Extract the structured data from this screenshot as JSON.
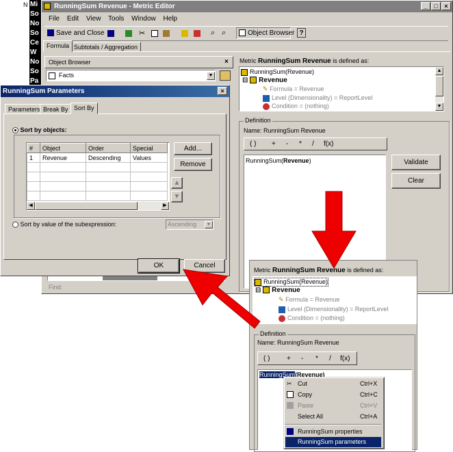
{
  "left_strip": {
    "items": [
      "Mi",
      "So",
      "No",
      "So",
      "Ce",
      "W",
      "No",
      "So",
      "Pa"
    ],
    "top_letter": "N"
  },
  "metric_editor": {
    "title": "RunningSum Revenue - Metric Editor",
    "menu": [
      "File",
      "Edit",
      "View",
      "Tools",
      "Window",
      "Help"
    ],
    "toolbar": {
      "save_close": "Save and Close",
      "object_browser": "Object Browser"
    },
    "tabs": [
      "Formula",
      "Subtotals / Aggregation"
    ],
    "object_browser": {
      "label": "Object Browser",
      "select": "Facts",
      "find": "Find:"
    },
    "defined_as": {
      "prefix": "Metric",
      "name": "RunningSum Revenue",
      "suffix": "is defined as:"
    },
    "tree": {
      "root": "RunningSum(Revenue)",
      "child": "Revenue",
      "formula": "Formula = Revenue",
      "level": "Level (Dimensionality) = ReportLevel",
      "condition": "Condition = (nothing)"
    },
    "definition": {
      "group": "Definition",
      "name_label": "Name:",
      "name_value": "RunningSum Revenue",
      "ops": [
        "( )",
        "+",
        "-",
        "*",
        "/",
        "f(x)"
      ],
      "expr_func": "RunningSum(",
      "expr_arg": "Revenue",
      "expr_close": ")",
      "validate": "Validate",
      "clear": "Clear"
    }
  },
  "params_dialog": {
    "title": "RunningSum Parameters",
    "tabs": [
      "Parameters",
      "Break By",
      "Sort By"
    ],
    "sort_by_objects": "Sort by objects:",
    "columns": [
      "#",
      "Object",
      "Order",
      "Special"
    ],
    "rows": [
      [
        "1",
        "Revenue",
        "Descending",
        "Values"
      ]
    ],
    "add": "Add...",
    "remove": "Remove",
    "sort_by_value": "Sort by value of the subexpression:",
    "order_select": "Ascending",
    "ok": "OK",
    "cancel": "Cancel"
  },
  "zoom_panel": {
    "defined_as": {
      "prefix": "Metric",
      "name": "RunningSum Revenue",
      "suffix": "is defined as:"
    },
    "tree": {
      "root": "RunningSum(Revenue)",
      "child": "Revenue",
      "formula": "Formula = Revenue",
      "level": "Level (Dimensionality) = ReportLevel",
      "condition": "Condition = (nothing)"
    },
    "definition": {
      "group": "Definition",
      "name_label": "Name:",
      "name_value": "RunningSum Revenue",
      "ops": [
        "( )",
        "+",
        "-",
        "*",
        "/",
        "f(x)"
      ],
      "expr_func": "RunningSum",
      "expr_rest": "(Revenue)"
    },
    "context_menu": [
      {
        "label": "Cut",
        "key": "Ctrl+X",
        "enabled": true
      },
      {
        "label": "Copy",
        "key": "Ctrl+C",
        "enabled": true
      },
      {
        "label": "Paste",
        "key": "Ctrl+V",
        "enabled": false
      },
      {
        "label": "Select All",
        "key": "Ctrl+A",
        "enabled": true
      },
      {
        "label": "RunningSum properties",
        "key": "",
        "enabled": true
      },
      {
        "label": "RunningSum parameters",
        "key": "",
        "enabled": true,
        "highlighted": true
      }
    ]
  },
  "colors": {
    "arrow": "#ee0000",
    "title_active": "#0a246a",
    "title_inactive": "#808080",
    "highlight": "#0a246a"
  }
}
